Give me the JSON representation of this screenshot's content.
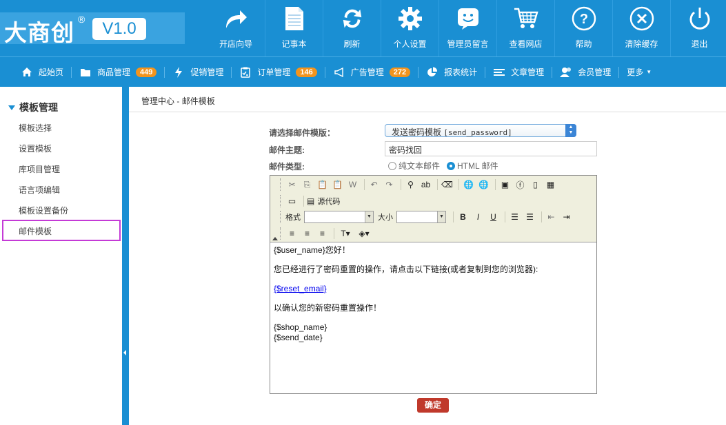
{
  "brand": {
    "logo_text": "大商创",
    "registered": "®",
    "version": "V1.0"
  },
  "top_nav": [
    {
      "label": "开店向导",
      "icon": "share-arrow-icon"
    },
    {
      "label": "记事本",
      "icon": "notepad-icon"
    },
    {
      "label": "刷新",
      "icon": "refresh-icon"
    },
    {
      "label": "个人设置",
      "icon": "gear-icon"
    },
    {
      "label": "管理员留言",
      "icon": "message-icon"
    },
    {
      "label": "查看网店",
      "icon": "cart-icon"
    },
    {
      "label": "帮助",
      "icon": "help-icon"
    },
    {
      "label": "清除缓存",
      "icon": "clear-cache-icon"
    },
    {
      "label": "退出",
      "icon": "power-icon"
    }
  ],
  "nav": {
    "home": "起始页",
    "goods": "商品管理",
    "goods_count": "449",
    "promo": "促销管理",
    "orders": "订单管理",
    "orders_count": "146",
    "ads": "广告管理",
    "ads_count": "272",
    "reports": "报表统计",
    "articles": "文章管理",
    "members": "会员管理",
    "more": "更多"
  },
  "sidebar": {
    "title": "模板管理",
    "items": [
      "模板选择",
      "设置模板",
      "库项目管理",
      "语言项编辑",
      "模板设置备份",
      "邮件模板"
    ]
  },
  "breadcrumb": {
    "root": "管理中心",
    "sep": " - ",
    "current": "邮件模板"
  },
  "form": {
    "template_label": "请选择邮件模版：",
    "template_name": "发送密码模板",
    "template_code": "[send_password]",
    "subject_label": "邮件主题:",
    "subject_value": "密码找回",
    "type_label": "邮件类型:",
    "type_plain": "纯文本邮件",
    "type_html": "HTML 邮件",
    "type_selected": "html"
  },
  "editor": {
    "source_label": "源代码",
    "format_label": "格式",
    "size_label": "大小",
    "content": {
      "line1": "{$user_name}您好！",
      "line2": "您已经进行了密码重置的操作，请点击以下链接(或者复制到您的浏览器):",
      "link": "{$reset_email}",
      "line3": "以确认您的新密码重置操作！",
      "line4": "{$shop_name}",
      "line5": "{$send_date}"
    }
  },
  "submit_label": "确定",
  "colors": {
    "primary": "#1a8fd3",
    "badge": "#f3941d",
    "submit": "#c0392b",
    "highlight": "#c43ad6"
  }
}
